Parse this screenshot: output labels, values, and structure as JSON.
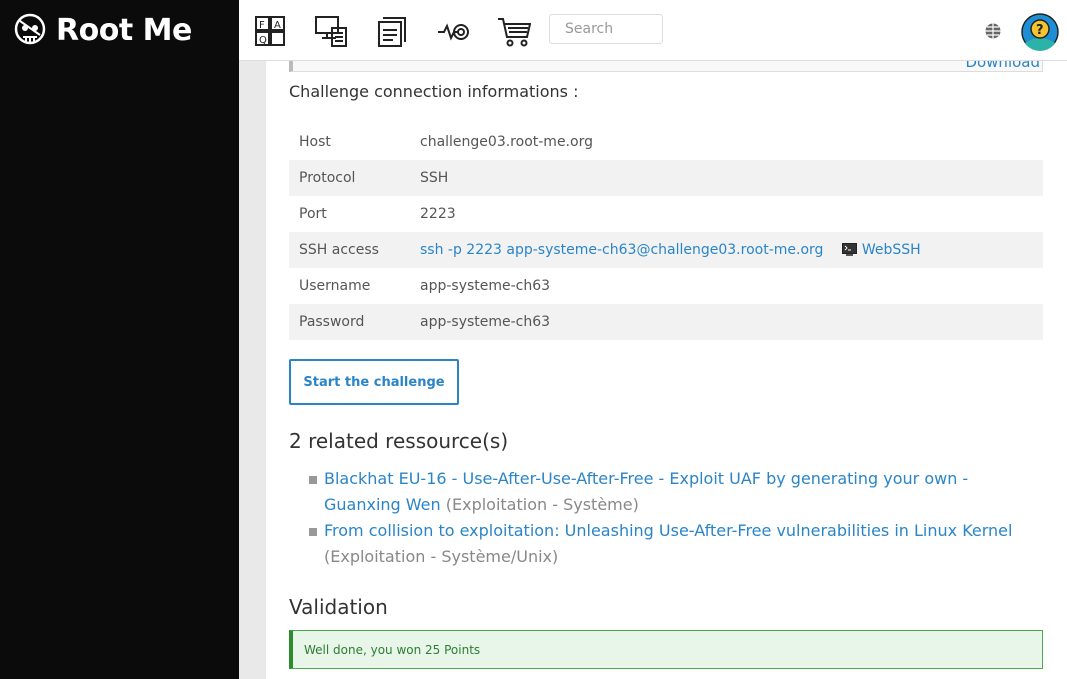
{
  "header": {
    "brand": "Root Me",
    "nav_icons": [
      "faq-icon",
      "challenges-icon",
      "documentation-icon",
      "ctf-radar-icon",
      "shop-cart-icon"
    ],
    "search": {
      "placeholder": "Search",
      "value": ""
    },
    "lang_icon": "globe-icon",
    "avatar_icon": "user-help-avatar-icon"
  },
  "previous_box": {
    "link": "Download"
  },
  "connection": {
    "intro": "Challenge connection informations :",
    "rows": [
      {
        "key": "Host",
        "value": "challenge03.root-me.org"
      },
      {
        "key": "Protocol",
        "value": "SSH"
      },
      {
        "key": "Port",
        "value": "2223"
      },
      {
        "key": "SSH access",
        "value": "ssh -p 2223 app-systeme-ch63@challenge03.root-me.org",
        "extra": "WebSSH"
      },
      {
        "key": "Username",
        "value": "app-systeme-ch63"
      },
      {
        "key": "Password",
        "value": "app-systeme-ch63"
      }
    ]
  },
  "start_button": "Start the challenge",
  "resources": {
    "title": "2 related ressource(s)",
    "items": [
      {
        "title": "Blackhat EU-16 - Use-After-Use-After-Free - Exploit UAF by generating your own - Guanxing Wen",
        "category": "(Exploitation - Système)"
      },
      {
        "title": "From collision to exploitation: Unleashing Use-After-Free vulnerabilities in Linux Kernel",
        "category": "(Exploitation - Système/Unix)"
      }
    ]
  },
  "validation": {
    "title": "Validation",
    "message": "Well done, you won 25 Points"
  },
  "colors": {
    "link": "#2a85c8",
    "sidebar": "#0b0b0b",
    "success_bg": "#e8f5e9",
    "success_border": "#2e8b2e"
  }
}
